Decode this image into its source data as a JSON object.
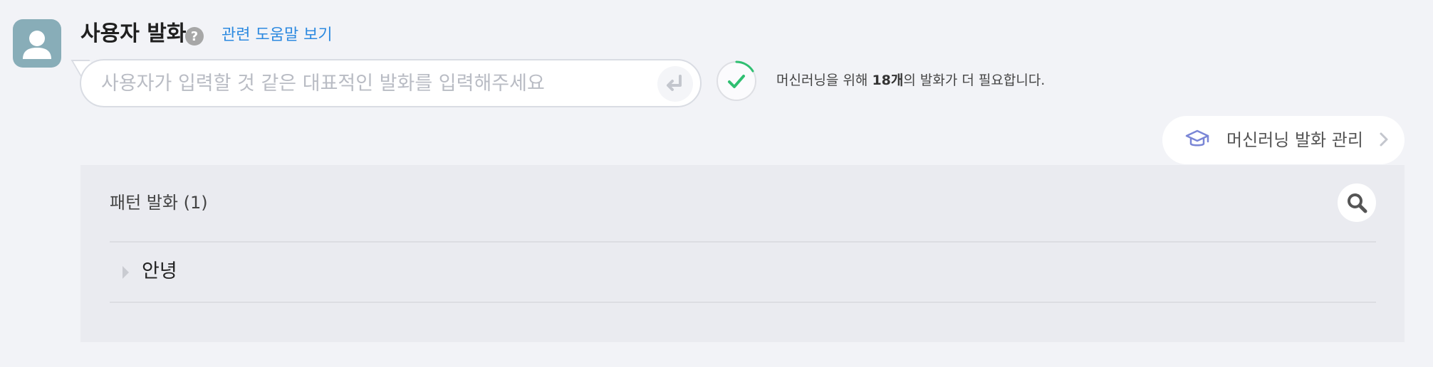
{
  "header": {
    "title": "사용자 발화",
    "help_icon": "question-circle-icon",
    "help_link": "관련 도움말 보기"
  },
  "utterance_input": {
    "placeholder": "사용자가 입력할 것 같은 대표적인 발화를 입력해주세요",
    "value": "",
    "enter_icon": "enter-return-icon"
  },
  "ml_status": {
    "icon": "check-progress-icon",
    "prefix": "머신러닝을 위해 ",
    "count": "18개",
    "suffix": "의 발화가 더 필요합니다.",
    "color": "#2fbf71"
  },
  "ml_manage_button": {
    "icon": "graduation-cap-icon",
    "label": "머신러닝 발화 관리"
  },
  "pattern_panel": {
    "title": "패턴 발화 (1)",
    "search_icon": "search-icon",
    "items": [
      {
        "label": "안녕"
      }
    ]
  }
}
